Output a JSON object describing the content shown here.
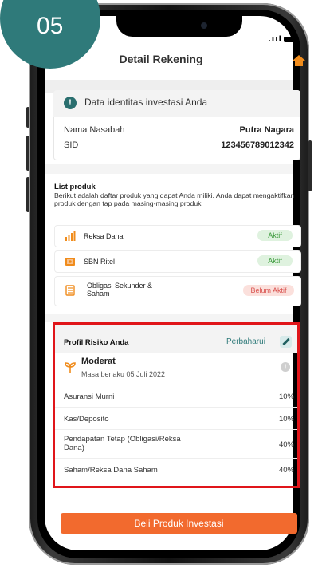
{
  "step": {
    "number": "05"
  },
  "header": {
    "title": "Detail Rekening",
    "home_icon": "home-icon"
  },
  "account_info": {
    "header": "Data identitas investasi Anda",
    "info_icon_glyph": "!",
    "rows": [
      {
        "label": "Nama Nasabah",
        "value": "Putra Nagara"
      },
      {
        "label": "SID",
        "value": "123456789012342"
      }
    ]
  },
  "products": {
    "title": "List produk",
    "description": "Berikut adalah daftar produk yang dapat Anda miliki. Anda dapat mengaktifkan produk dengan tap pada masing-masing produk",
    "items": [
      {
        "label": "Reksa Dana",
        "status": "Aktif",
        "icon": "chart-bar-icon"
      },
      {
        "label": "SBN Ritel",
        "status": "Aktif",
        "icon": "bond-certificate-icon"
      },
      {
        "label": "Obligasi Sekunder & Saham",
        "status": "Belum Aktif",
        "icon": "document-list-icon"
      }
    ]
  },
  "risk_profile": {
    "title": "Profil Risiko Anda",
    "update_label": "Perbaharui",
    "level": "Moderat",
    "validity": "Masa berlaku 05 Juli 2022",
    "info_glyph": "!",
    "allocations": [
      {
        "label": "Asuransi Murni",
        "value": "10%"
      },
      {
        "label": "Kas/Deposito",
        "value": "10%"
      },
      {
        "label": "Pendapatan Tetap (Obligasi/Reksa Dana)",
        "value": "40%"
      },
      {
        "label": "Saham/Reksa Dana Saham",
        "value": "40%"
      }
    ]
  },
  "cta": {
    "label": "Beli Produk Investasi"
  },
  "colors": {
    "accent_teal": "#2f7a7a",
    "cta_orange": "#f26a2e",
    "highlight_red": "#e0151a",
    "active_green": "#3b9a3b",
    "inactive_red": "#d9534f"
  }
}
